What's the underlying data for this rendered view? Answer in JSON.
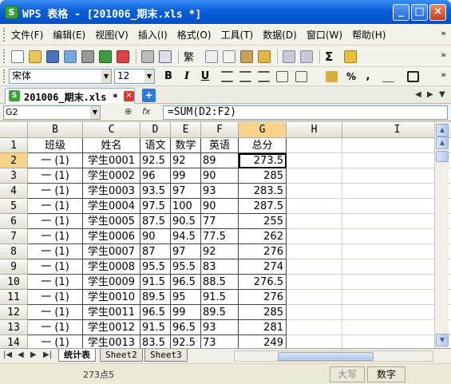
{
  "window": {
    "icon": "S",
    "title": "WPS 表格 - [201006_期末.xls *]",
    "minimize_glyph": "_",
    "maximize_glyph": "□",
    "close_glyph": "×"
  },
  "menu": {
    "items": [
      "文件(F)",
      "编辑(E)",
      "视图(V)",
      "插入(I)",
      "格式(O)",
      "工具(T)",
      "数据(D)",
      "窗口(W)",
      "帮助(H)"
    ],
    "overflow": "»"
  },
  "formatting": {
    "font_name": "宋体",
    "font_size": "12",
    "bold": "B",
    "italic": "I",
    "underline": "U",
    "percent": "%",
    "thousands": ","
  },
  "toolbar": {
    "cjk_button": "繁",
    "sigma": "Σ"
  },
  "doc_tab": {
    "icon": "S",
    "label": "201006_期末.xls *",
    "close": "×",
    "new_tab": "+"
  },
  "formula_bar": {
    "name_box": "G2",
    "fx": "fx",
    "formula": "=SUM(D2:F2)"
  },
  "columns": [
    "B",
    "C",
    "D",
    "E",
    "F",
    "G",
    "H",
    "I"
  ],
  "selected_column": "G",
  "rows": [
    {
      "n": "1",
      "b": "班级",
      "c": "姓名",
      "d": "语文",
      "e": "数学",
      "f": "英语",
      "g": "总分"
    },
    {
      "n": "2",
      "b": "一 (1)",
      "c": "学生0001",
      "d": "92.5",
      "e": "92",
      "f": "89",
      "g": "273.5"
    },
    {
      "n": "3",
      "b": "一 (1)",
      "c": "学生0002",
      "d": "96",
      "e": "99",
      "f": "90",
      "g": "285"
    },
    {
      "n": "4",
      "b": "一 (1)",
      "c": "学生0003",
      "d": "93.5",
      "e": "97",
      "f": "93",
      "g": "283.5"
    },
    {
      "n": "5",
      "b": "一 (1)",
      "c": "学生0004",
      "d": "97.5",
      "e": "100",
      "f": "90",
      "g": "287.5"
    },
    {
      "n": "6",
      "b": "一 (1)",
      "c": "学生0005",
      "d": "87.5",
      "e": "90.5",
      "f": "77",
      "g": "255"
    },
    {
      "n": "7",
      "b": "一 (1)",
      "c": "学生0006",
      "d": "90",
      "e": "94.5",
      "f": "77.5",
      "g": "262"
    },
    {
      "n": "8",
      "b": "一 (1)",
      "c": "学生0007",
      "d": "87",
      "e": "97",
      "f": "92",
      "g": "276"
    },
    {
      "n": "9",
      "b": "一 (1)",
      "c": "学生0008",
      "d": "95.5",
      "e": "95.5",
      "f": "83",
      "g": "274"
    },
    {
      "n": "10",
      "b": "一 (1)",
      "c": "学生0009",
      "d": "91.5",
      "e": "96.5",
      "f": "88.5",
      "g": "276.5"
    },
    {
      "n": "11",
      "b": "一 (1)",
      "c": "学生0010",
      "d": "89.5",
      "e": "95",
      "f": "91.5",
      "g": "276"
    },
    {
      "n": "12",
      "b": "一 (1)",
      "c": "学生0011",
      "d": "96.5",
      "e": "99",
      "f": "89.5",
      "g": "285"
    },
    {
      "n": "13",
      "b": "一 (1)",
      "c": "学生0012",
      "d": "91.5",
      "e": "96.5",
      "f": "93",
      "g": "281"
    },
    {
      "n": "14",
      "b": "一 (1)",
      "c": "学生0013",
      "d": "83.5",
      "e": "92.5",
      "f": "73",
      "g": "249"
    }
  ],
  "sheets": [
    "统计表",
    "Sheet2",
    "Sheet3"
  ],
  "active_sheet": "统计表",
  "status": {
    "text": "273点5",
    "caps": "大写",
    "num": "数字"
  },
  "colors": {
    "title_bar": "#0a5fd8",
    "selected_header": "#f7d48a",
    "app_green": "#3aa23a"
  }
}
